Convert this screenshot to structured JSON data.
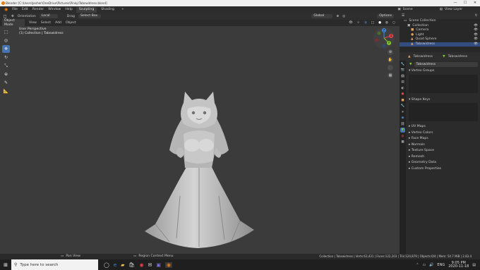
{
  "titlebar": {
    "text": "Blender [C:\\Users\\Jesher\\OneDrive\\Pictures\\Pinky\\Tabswidress.blend]",
    "controls": [
      "—",
      "☐",
      "✕"
    ]
  },
  "menu": {
    "items": [
      "File",
      "Edit",
      "Render",
      "Window",
      "Help"
    ],
    "tabs": [
      "Sculpting",
      "Shading",
      "+"
    ],
    "active_tab": "Sculpting",
    "scene": "Scene",
    "view_layer": "View Layer"
  },
  "tool_header": {
    "orientation_label": "Orientation",
    "orientation_value": "Local",
    "drag_label": "Drag",
    "drag_value": "Select Box",
    "transform": "Global",
    "options": "Options"
  },
  "mode_header": {
    "mode": "Object Mode",
    "items": [
      "View",
      "Select",
      "Add",
      "Object"
    ]
  },
  "viewport": {
    "view_name": "User Perspective",
    "collection_line": "(1) Collection | Tabswidress"
  },
  "gizmo": {
    "x": "X",
    "y": "Y",
    "z": "Z"
  },
  "outliner": {
    "root": "Scene Collection",
    "rows": [
      {
        "label": "Collection",
        "icon": "collection-icon",
        "color": "#d0d0d0"
      },
      {
        "label": "Camera",
        "icon": "camera-icon",
        "color": "#e0a060"
      },
      {
        "label": "Light",
        "icon": "light-icon",
        "color": "#e0a060"
      },
      {
        "label": "Quad Sphere",
        "icon": "mesh-icon",
        "color": "#e0a060"
      },
      {
        "label": "Tabswidress",
        "icon": "mesh-icon",
        "color": "#e0a060"
      }
    ]
  },
  "properties": {
    "object_name": "Tabswidress",
    "mesh_tab": "Tabswidress",
    "mesh_name": "Tabswidress",
    "sections": {
      "vertex_groups": "Vertex Groups",
      "shape_keys": "Shape Keys",
      "collapsed": [
        "UV Maps",
        "Vertex Colors",
        "Face Maps",
        "Normals",
        "Texture Space",
        "Remesh",
        "Geometry Data",
        "Custom Properties"
      ]
    }
  },
  "statusbar": {
    "left": "Pan View",
    "mid": "Region Context Menu",
    "right": "Collection | Tabswidress | Verts:63,431 | Faces:122,203 | Tris:124,879 | Objects:0/4 | Mem: 54.7 MiB | 2.83.4"
  },
  "taskbar": {
    "search_placeholder": "Type here to search",
    "lang": "ENG",
    "time": "9:05 PM",
    "date": "2020-11-18"
  },
  "colors": {
    "accent": "#4772b3",
    "blender_orange": "#e87d0d",
    "axis_x": "#e8424b",
    "axis_y": "#7ec92b",
    "axis_z": "#3f8ae0"
  }
}
